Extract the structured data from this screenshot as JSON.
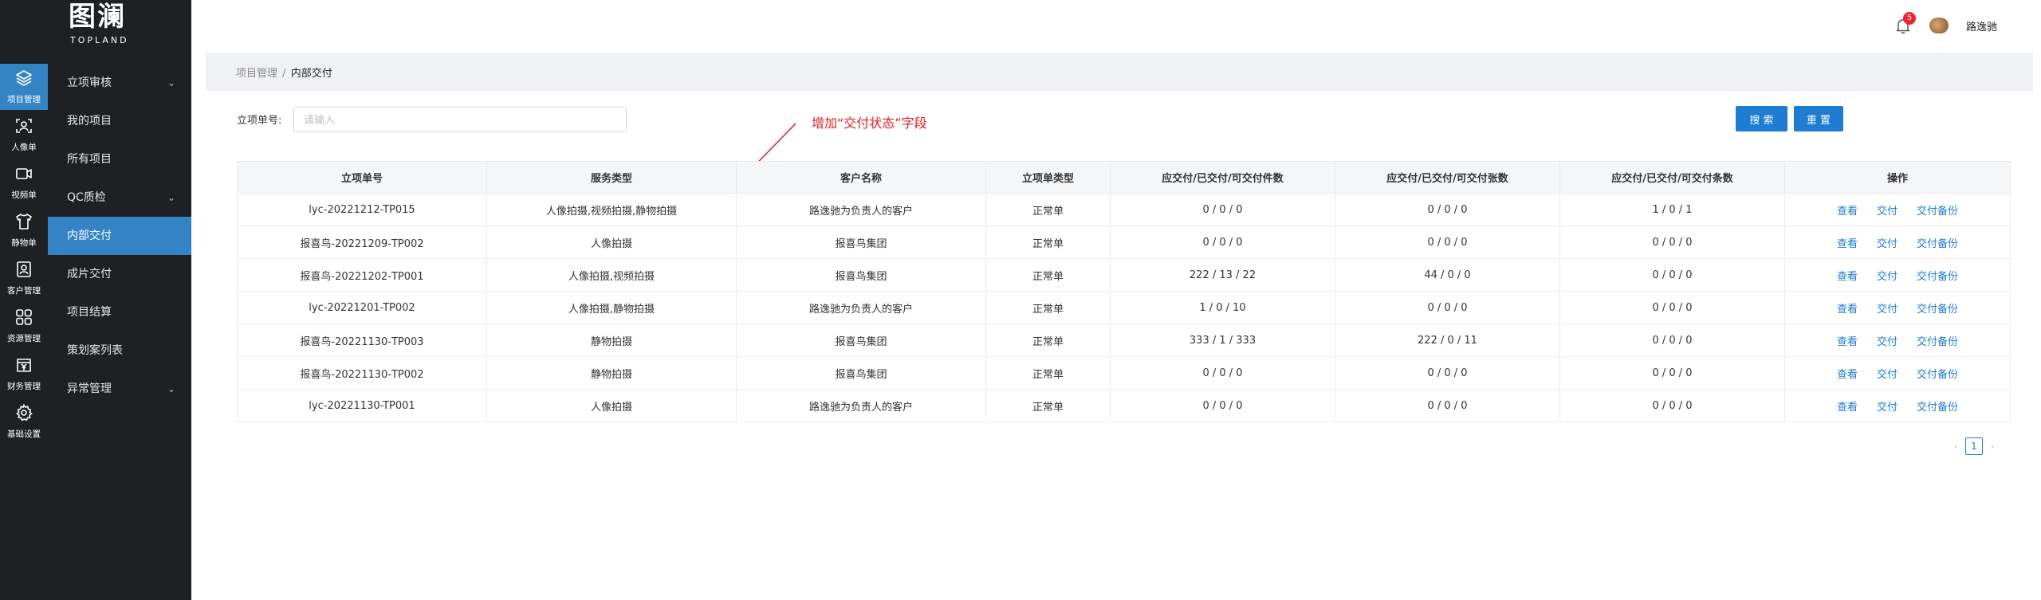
{
  "logo": {
    "main": "图澜",
    "sub": "TOPLAND"
  },
  "rail": [
    {
      "label": "项目管理",
      "icon": "layers-icon",
      "active": true
    },
    {
      "label": "人像单",
      "icon": "face-scan-icon"
    },
    {
      "label": "视频单",
      "icon": "video-camera-icon"
    },
    {
      "label": "静物单",
      "icon": "tshirt-icon"
    },
    {
      "label": "客户管理",
      "icon": "contact-card-icon"
    },
    {
      "label": "资源管理",
      "icon": "grid-icon"
    },
    {
      "label": "财务管理",
      "icon": "yen-icon"
    },
    {
      "label": "基础设置",
      "icon": "gear-icon"
    }
  ],
  "submenu": [
    {
      "label": "立项审核",
      "chevron": true
    },
    {
      "label": "我的项目"
    },
    {
      "label": "所有项目"
    },
    {
      "label": "QC质检",
      "chevron": true
    },
    {
      "label": "内部交付",
      "active": true
    },
    {
      "label": "成片交付"
    },
    {
      "label": "项目结算"
    },
    {
      "label": "策划案列表"
    },
    {
      "label": "异常管理",
      "chevron": true
    }
  ],
  "header": {
    "badge": "5",
    "user_name": "路逸驰"
  },
  "breadcrumb": {
    "parent": "项目管理",
    "separator": "/",
    "current": "内部交付"
  },
  "search": {
    "label": "立项单号:",
    "placeholder": "请输入",
    "search_button": "搜 索",
    "reset_button": "重 置"
  },
  "annotation": "增加“交付状态”字段",
  "table": {
    "columns": [
      "立项单号",
      "服务类型",
      "客户名称",
      "立项单类型",
      "应交付/已交付/可交付件数",
      "应交付/已交付/可交付张数",
      "应交付/已交付/可交付条数",
      "操作"
    ],
    "actions": [
      "查看",
      "交付",
      "交付备份"
    ],
    "rows": [
      [
        "lyc-20221212-TP015",
        "人像拍摄,视频拍摄,静物拍摄",
        "路逸驰为负责人的客户",
        "正常单",
        "0 / 0 / 0",
        "0 / 0 / 0",
        "1 / 0 / 1"
      ],
      [
        "报喜鸟-20221209-TP002",
        "人像拍摄",
        "报喜鸟集团",
        "正常单",
        "0 / 0 / 0",
        "0 / 0 / 0",
        "0 / 0 / 0"
      ],
      [
        "报喜鸟-20221202-TP001",
        "人像拍摄,视频拍摄",
        "报喜鸟集团",
        "正常单",
        "222 / 13 / 22",
        "44 / 0 / 0",
        "0 / 0 / 0"
      ],
      [
        "lyc-20221201-TP002",
        "人像拍摄,静物拍摄",
        "路逸驰为负责人的客户",
        "正常单",
        "1 / 0 / 10",
        "0 / 0 / 0",
        "0 / 0 / 0"
      ],
      [
        "报喜鸟-20221130-TP003",
        "静物拍摄",
        "报喜鸟集团",
        "正常单",
        "333 / 1 / 333",
        "222 / 0 / 11",
        "0 / 0 / 0"
      ],
      [
        "报喜鸟-20221130-TP002",
        "静物拍摄",
        "报喜鸟集团",
        "正常单",
        "0 / 0 / 0",
        "0 / 0 / 0",
        "0 / 0 / 0"
      ],
      [
        "lyc-20221130-TP001",
        "人像拍摄",
        "路逸驰为负责人的客户",
        "正常单",
        "0 / 0 / 0",
        "0 / 0 / 0",
        "0 / 0 / 0"
      ]
    ]
  },
  "pagination": {
    "prev": "‹",
    "current": "1",
    "next": "›"
  },
  "colors": {
    "sidebar": "#1d2124",
    "accent": "#3383c5",
    "button": "#1e7cd2",
    "annotation": "#e02020"
  }
}
